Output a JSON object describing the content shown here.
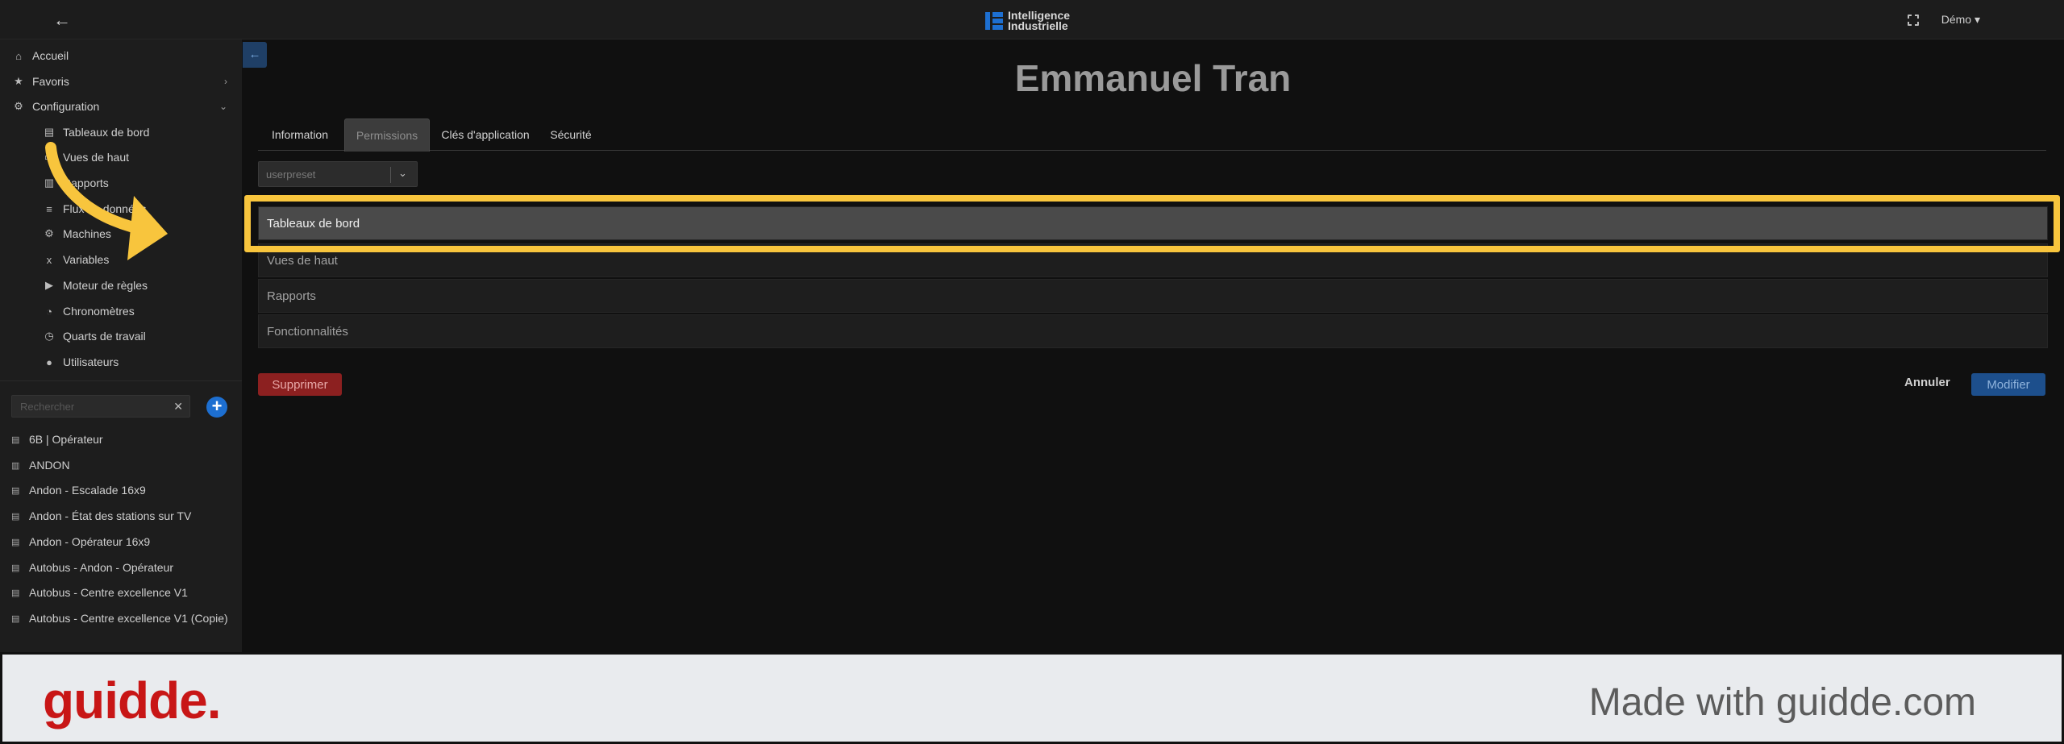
{
  "header": {
    "back_label": "←",
    "logo_line1": "Intelligence",
    "logo_line2": "Industrielle",
    "user_menu": "Démo ▾"
  },
  "sidebar": {
    "nav": [
      {
        "label": "Accueil",
        "icon": "home-icon"
      },
      {
        "label": "Favoris",
        "icon": "star-icon"
      },
      {
        "label": "Configuration",
        "icon": "gear-icon"
      }
    ],
    "config_items": [
      {
        "label": "Tableaux de bord",
        "icon": "dashboard-icon"
      },
      {
        "label": "Vues de haut",
        "icon": "monitor-icon"
      },
      {
        "label": "Rapports",
        "icon": "report-icon"
      },
      {
        "label": "Flux de données",
        "icon": "database-icon"
      },
      {
        "label": "Machines",
        "icon": "machines-icon"
      },
      {
        "label": "Variables",
        "icon": "variable-icon"
      },
      {
        "label": "Moteur de règles",
        "icon": "play-icon"
      },
      {
        "label": "Chronomètres",
        "icon": "stopwatch-icon"
      },
      {
        "label": "Quarts de travail",
        "icon": "clock-icon"
      },
      {
        "label": "Utilisateurs",
        "icon": "user-icon"
      }
    ],
    "search_placeholder": "Rechercher",
    "dashboards": [
      "6B | Opérateur",
      "ANDON",
      "Andon - Escalade 16x9",
      "Andon - État des stations sur TV",
      "Andon - Opérateur 16x9",
      "Autobus - Andon - Opérateur",
      "Autobus - Centre excellence V1",
      "Autobus - Centre excellence V1 (Copie)"
    ]
  },
  "main": {
    "title": "Emmanuel Tran",
    "tabs": [
      "Information",
      "Permissions",
      "Clés d'application",
      "Sécurité"
    ],
    "active_tab": "Permissions",
    "preset_value": "userpreset",
    "permission_rows": [
      "Tableaux de bord",
      "Vues de haut",
      "Rapports",
      "Fonctionnalités"
    ],
    "delete_label": "Supprimer",
    "cancel_label": "Annuler",
    "modify_label": "Modifier"
  },
  "footer": {
    "brand": "guidde.",
    "made_with": "Made with guidde.com"
  },
  "colors": {
    "accent": "#1d6fd1",
    "highlight": "#f8c53d",
    "danger": "#8c2020",
    "brand": "#c81616"
  }
}
